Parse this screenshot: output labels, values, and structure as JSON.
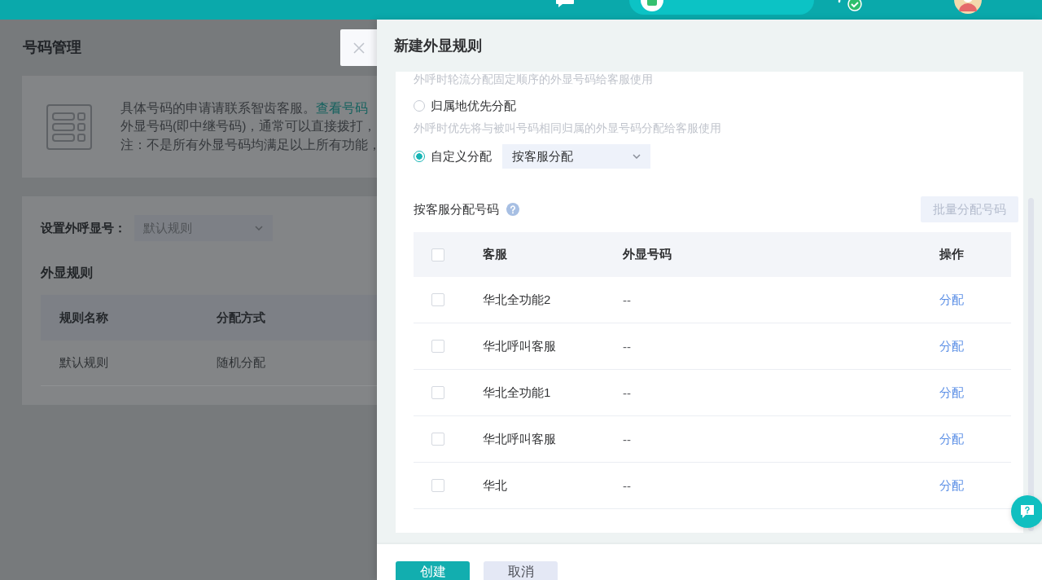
{
  "top_bar": {
    "items": [
      {
        "kind": "messages"
      },
      {
        "kind": "status"
      },
      {
        "kind": "workbench"
      },
      {
        "kind": "user"
      }
    ]
  },
  "page": {
    "title": "号码管理",
    "notice": {
      "lines": [
        {
          "text": "具体号码的申请请联系智齿客服。",
          "link": "查看号码"
        },
        {
          "text": "外显号码(即中继号码)，通常可以直接拨打，"
        },
        {
          "text": "注：不是所有外显号码均满足以上所有功能，"
        }
      ]
    },
    "caller_id": {
      "label": "设置外呼显号：",
      "value": "默认规则"
    },
    "rules": {
      "title": "外显规则",
      "columns": [
        "规则名称",
        "分配方式"
      ],
      "rows": [
        [
          "默认规则",
          "随机分配"
        ]
      ]
    }
  },
  "drawer": {
    "title": "新建外显规则",
    "top_hint": "外呼时轮流分配固定顺序的外显号码给客服使用",
    "options": [
      {
        "label": "归属地优先分配",
        "selected": false,
        "hint": "外呼时优先将与被叫号码相同归属的外显号码分配给客服使用"
      },
      {
        "label": "自定义分配",
        "selected": true,
        "select": "按客服分配"
      }
    ],
    "assign": {
      "title": "按客服分配号码",
      "batch_button": {
        "label": "批量分配号码",
        "disabled": true
      },
      "columns": [
        "客服",
        "外显号码",
        "操作"
      ],
      "header_checked": false,
      "rows": [
        {
          "agent": "华北全功能2",
          "number": "--",
          "action": "分配",
          "checked": false
        },
        {
          "agent": "华北呼叫客服",
          "number": "--",
          "action": "分配",
          "checked": false
        },
        {
          "agent": "华北全功能1",
          "number": "--",
          "action": "分配",
          "checked": false
        },
        {
          "agent": "华北呼叫客服",
          "number": "--",
          "action": "分配",
          "checked": false
        },
        {
          "agent": "华北",
          "number": "--",
          "action": "分配",
          "checked": false
        }
      ]
    },
    "buttons": [
      {
        "label": "创建",
        "kind": "primary"
      },
      {
        "label": "取消",
        "kind": "secondary"
      }
    ]
  }
}
